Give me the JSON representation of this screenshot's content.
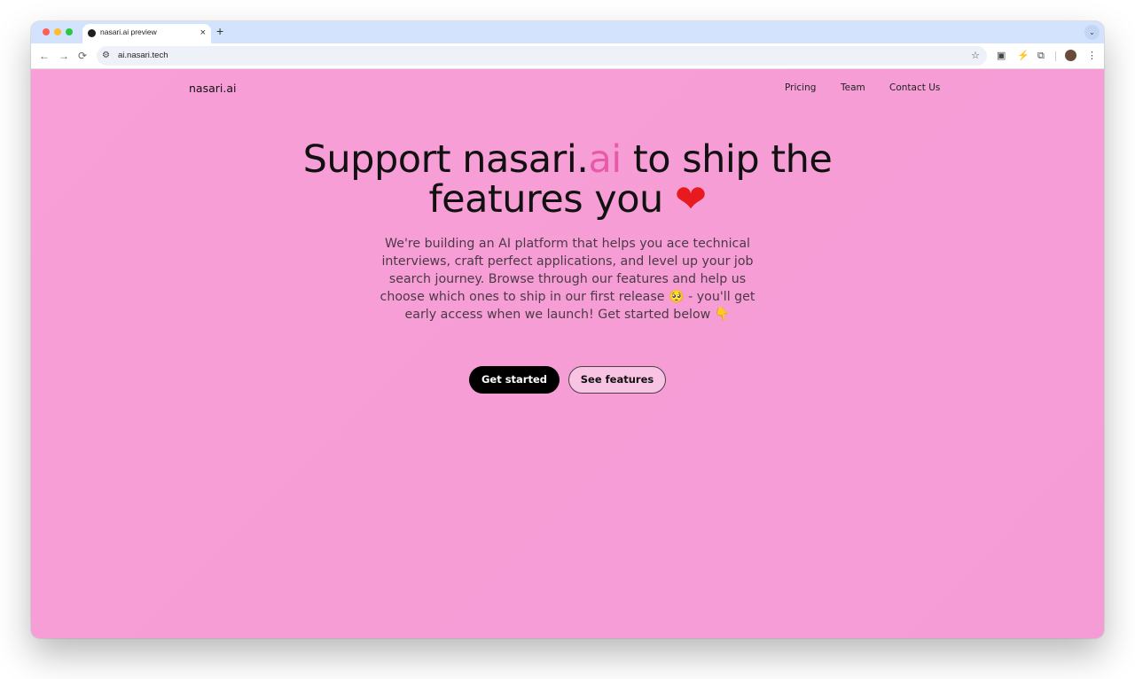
{
  "browser": {
    "tab_title": "nasari.ai preview",
    "tab_close": "×",
    "new_tab": "+",
    "url": "ai.nasari.tech",
    "icons": {
      "back": "←",
      "forward": "→",
      "reload": "⟳",
      "site_info": "⚙",
      "star": "☆",
      "pip": "▣",
      "bolt": "⚡",
      "extensions": "⧉",
      "menu": "⋮",
      "dropdown": "⌄"
    }
  },
  "nav": {
    "brand": "nasari.ai",
    "links": [
      "Pricing",
      "Team",
      "Contact Us"
    ]
  },
  "hero": {
    "title_part1": "Support nasari.",
    "title_accent": "ai",
    "title_part2": " to ship the features you ",
    "title_heart": "❤",
    "description": "We're building an AI platform that helps you ace technical interviews, craft perfect applications, and level up your job search journey. Browse through our features and help us choose which ones to ship in our first release 🥺 - you'll get early access when we launch! Get started below 👇",
    "primary_button": "Get started",
    "secondary_button": "See features"
  },
  "colors": {
    "page_bg": "#f89fd7",
    "accent": "#e85aa8",
    "heart": "#e8191f",
    "primary_button_bg": "#000000"
  }
}
